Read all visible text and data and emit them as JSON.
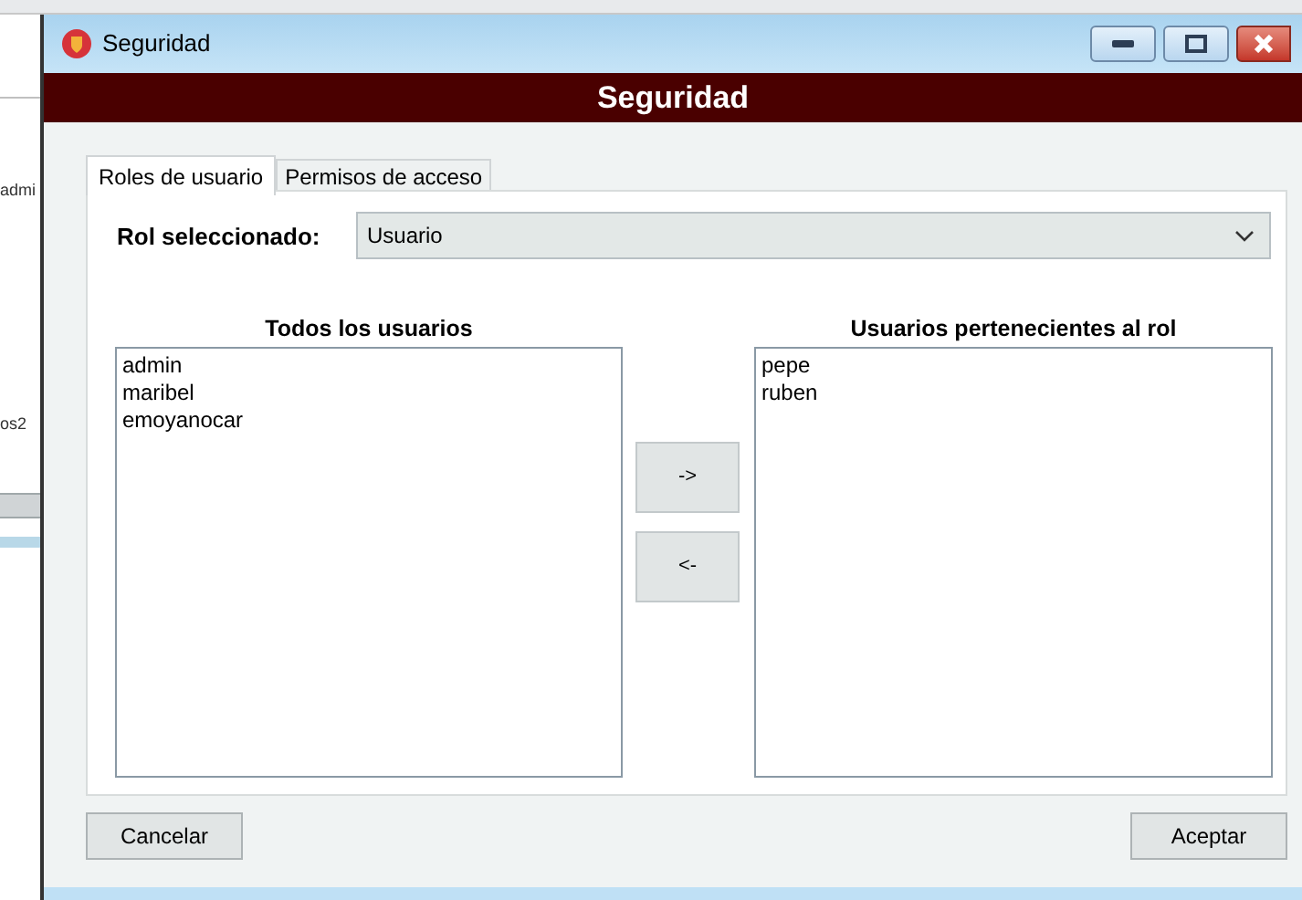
{
  "background_window": {
    "texts": [
      "admi",
      "os2"
    ]
  },
  "window": {
    "title": "Seguridad"
  },
  "banner": {
    "title": "Seguridad"
  },
  "tabs": [
    {
      "label": "Roles de usuario",
      "selected": true
    },
    {
      "label": "Permisos de acceso",
      "selected": false
    }
  ],
  "role_select": {
    "label": "Rol seleccionado:",
    "value": "Usuario"
  },
  "all_users": {
    "heading": "Todos los usuarios",
    "items": [
      "admin",
      "maribel",
      "emoyanocar"
    ]
  },
  "role_users": {
    "heading": "Usuarios pertenecientes al rol",
    "items": [
      "pepe",
      "ruben"
    ]
  },
  "transfer_buttons": [
    "->",
    "<-"
  ],
  "buttons": {
    "cancel": "Cancelar",
    "accept": "Aceptar"
  }
}
